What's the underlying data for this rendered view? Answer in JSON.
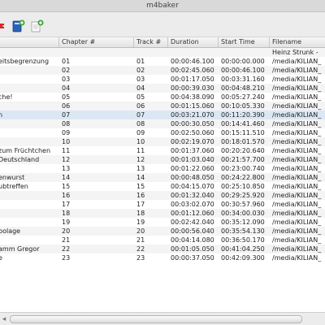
{
  "window": {
    "title": "m4baker"
  },
  "toolbar": {
    "icons": [
      "red-mark-icon",
      "add-book-icon",
      "add-chapter-icon"
    ]
  },
  "table": {
    "columns": [
      "",
      "Chapter #",
      "Track #",
      "Duration",
      "Start Time",
      "Filename"
    ],
    "rows": [
      [
        "",
        "",
        "",
        "",
        "",
        "Heinz Strunk -"
      ],
      [
        "eitsbegrenzung",
        "01",
        "01",
        "00:00:46.100",
        "00:00:00.000",
        "/media/KILIAN_"
      ],
      [
        "",
        "02",
        "02",
        "00:02:45.060",
        "00:00:46.100",
        "/media/KILIAN_"
      ],
      [
        "",
        "03",
        "03",
        "00:01:17.050",
        "00:03:31.160",
        "/media/KILIAN_"
      ],
      [
        "",
        "04",
        "04",
        "00:00:39.030",
        "00:04:48.210",
        "/media/KILIAN_"
      ],
      [
        "che!",
        "05",
        "05",
        "00:04:38.090",
        "00:05:27.240",
        "/media/KILIAN_"
      ],
      [
        "",
        "06",
        "06",
        "00:01:15.060",
        "00:10:05.330",
        "/media/KILIAN_"
      ],
      [
        "n",
        "07",
        "07",
        "00:03:21.070",
        "00:11:20.390",
        "/media/KILIAN_"
      ],
      [
        "",
        "08",
        "08",
        "00:00:30.050",
        "00:14:41.460",
        "/media/KILIAN_"
      ],
      [
        "",
        "09",
        "09",
        "00:02:50.060",
        "00:15:11.510",
        "/media/KILIAN_"
      ],
      [
        "",
        "10",
        "10",
        "00:02:19.070",
        "00:18:01.570",
        "/media/KILIAN_"
      ],
      [
        "zum Früchtchen",
        "11",
        "11",
        "00:01:37.060",
        "00:20:20.640",
        "/media/KILIAN_"
      ],
      [
        "Deutschland",
        "12",
        "12",
        "00:01:03.040",
        "00:21:57.700",
        "/media/KILIAN_"
      ],
      [
        "",
        "13",
        "13",
        "00:01:22.060",
        "00:23:00.740",
        "/media/KILIAN_"
      ],
      [
        "enwurst",
        "14",
        "14",
        "00:00:48.050",
        "00:24:22.800",
        "/media/KILIAN_"
      ],
      [
        "ubtreffen",
        "15",
        "15",
        "00:04:15.070",
        "00:25:10.850",
        "/media/KILIAN_"
      ],
      [
        "",
        "16",
        "16",
        "00:01:32.040",
        "00:29:25.920",
        "/media/KILIAN_"
      ],
      [
        "",
        "17",
        "17",
        "00:03:02.070",
        "00:30:57.960",
        "/media/KILIAN_"
      ],
      [
        "",
        "18",
        "18",
        "00:01:12.060",
        "00:34:00.030",
        "/media/KILIAN_"
      ],
      [
        "",
        "19",
        "19",
        "00:02:42.040",
        "00:35:12.090",
        "/media/KILIAN_"
      ],
      [
        "bolage",
        "20",
        "20",
        "00:00:56.040",
        "00:35:54.130",
        "/media/KILIAN_"
      ],
      [
        "",
        "21",
        "21",
        "00:04:14.080",
        "00:36:50.170",
        "/media/KILIAN_"
      ],
      [
        "amm Gregor",
        "22",
        "22",
        "00:01:05.050",
        "00:41:04.250",
        "/media/KILIAN_"
      ],
      [
        "e",
        "23",
        "23",
        "00:00:37.050",
        "00:42:09.300",
        "/media/KILIAN_"
      ]
    ],
    "selected_row": 7
  },
  "colors": {
    "selected_row": "#dbe8f4",
    "toolbar_bg": "#ececec",
    "red_mark": "#d9252b",
    "book_blue": "#2a62b5",
    "plus_green": "#3aa33a"
  }
}
